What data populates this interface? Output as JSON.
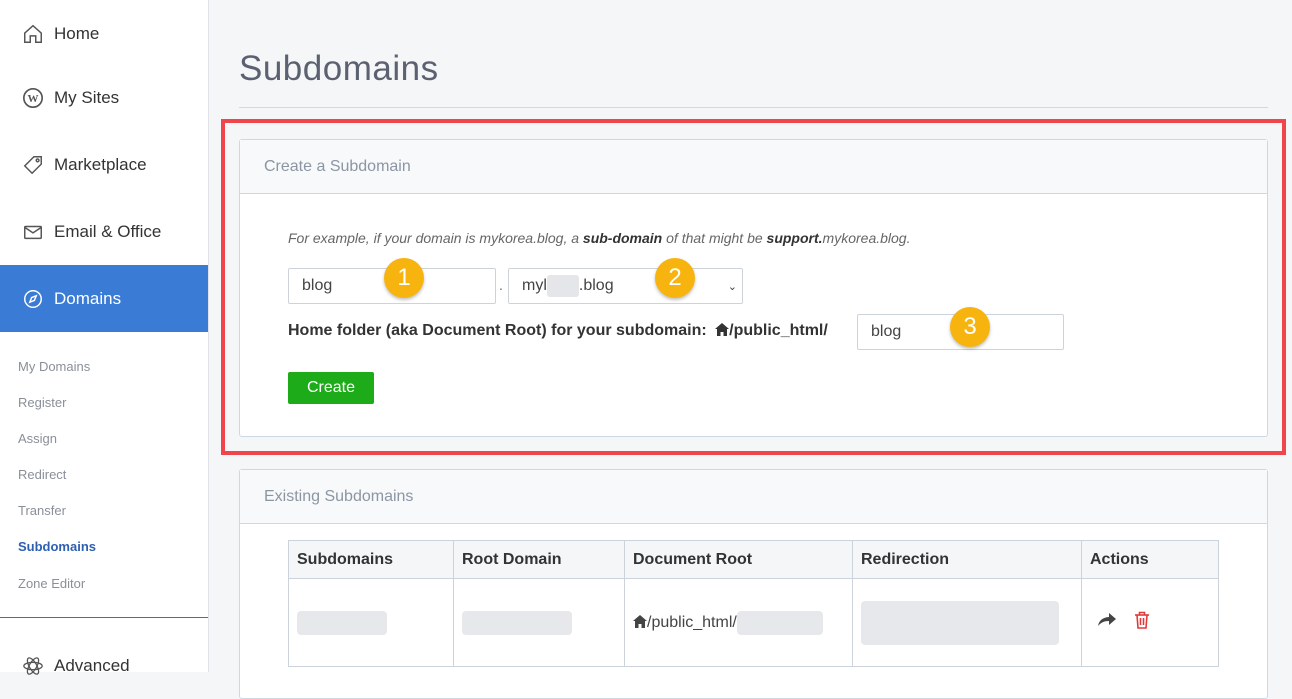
{
  "sidebar": {
    "items": [
      {
        "label": "Home",
        "icon": "home-icon"
      },
      {
        "label": "My Sites",
        "icon": "wordpress-icon"
      },
      {
        "label": "Marketplace",
        "icon": "tag-icon"
      },
      {
        "label": "Email & Office",
        "icon": "envelope-icon"
      },
      {
        "label": "Domains",
        "icon": "compass-icon",
        "active": true
      }
    ],
    "sub_items": [
      "My Domains",
      "Register",
      "Assign",
      "Redirect",
      "Transfer",
      "Subdomains",
      "Zone Editor"
    ],
    "current_sub": "Subdomains",
    "advanced_label": "Advanced"
  },
  "page": {
    "title": "Subdomains"
  },
  "create_card": {
    "title": "Create a Subdomain",
    "hint_parts": [
      "For example, if your domain is mykorea.blog, a ",
      "sub-domain",
      " of that might be ",
      "support.",
      "mykorea.blog."
    ],
    "subdomain_value": "blog",
    "separator": ".",
    "domain_prefix": "myl",
    "domain_suffix": ".blog",
    "folder_label": "Home folder (aka Document Root) for your subdomain:",
    "folder_path": "/public_html/",
    "folder_value": "blog",
    "create_label": "Create",
    "badges": [
      "1",
      "2",
      "3"
    ]
  },
  "existing_card": {
    "title": "Existing Subdomains",
    "columns": [
      "Subdomains",
      "Root Domain",
      "Document Root",
      "Redirection",
      "Actions"
    ],
    "row_docroot": "/public_html/"
  },
  "colors": {
    "accent": "#3a7bd5",
    "create_button": "#1eab19",
    "highlight": "#f0454b",
    "badge": "#f7b40e",
    "delete": "#e03b3b"
  }
}
